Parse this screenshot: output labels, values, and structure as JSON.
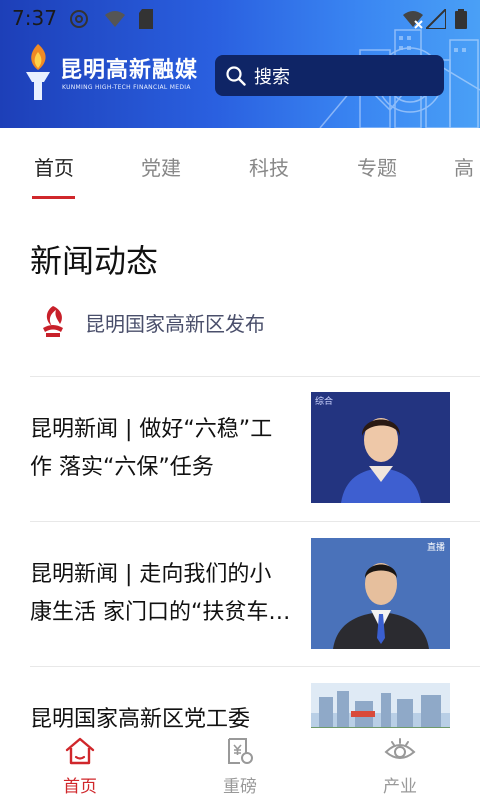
{
  "statusbar": {
    "time": "7:37"
  },
  "brand": {
    "title": "昆明高新融媒",
    "subtitle": "KUNMING HIGH-TECH FINANCIAL MEDIA"
  },
  "search": {
    "placeholder": "搜索"
  },
  "tabs": [
    {
      "label": "首页",
      "active": true
    },
    {
      "label": "党建"
    },
    {
      "label": "科技"
    },
    {
      "label": "专题"
    },
    {
      "label": "高"
    }
  ],
  "section": {
    "title": "新闻动态",
    "source": "昆明国家高新区发布"
  },
  "news": [
    {
      "title": "昆明新闻 | 做好“六稳”工作 落实“六保”任务",
      "thumb_tag": "综合"
    },
    {
      "title": "昆明新闻 | 走向我们的小康生活 家门口的“扶贫车间”",
      "thumb_tag": "直播"
    },
    {
      "title": "昆明国家高新区党工委"
    }
  ],
  "bottomnav": [
    {
      "label": "首页",
      "active": true
    },
    {
      "label": "重磅"
    },
    {
      "label": "产业"
    }
  ],
  "colors": {
    "accent": "#d0272b",
    "header_dark": "#0f2566",
    "header_blue": "#2a60e0"
  }
}
